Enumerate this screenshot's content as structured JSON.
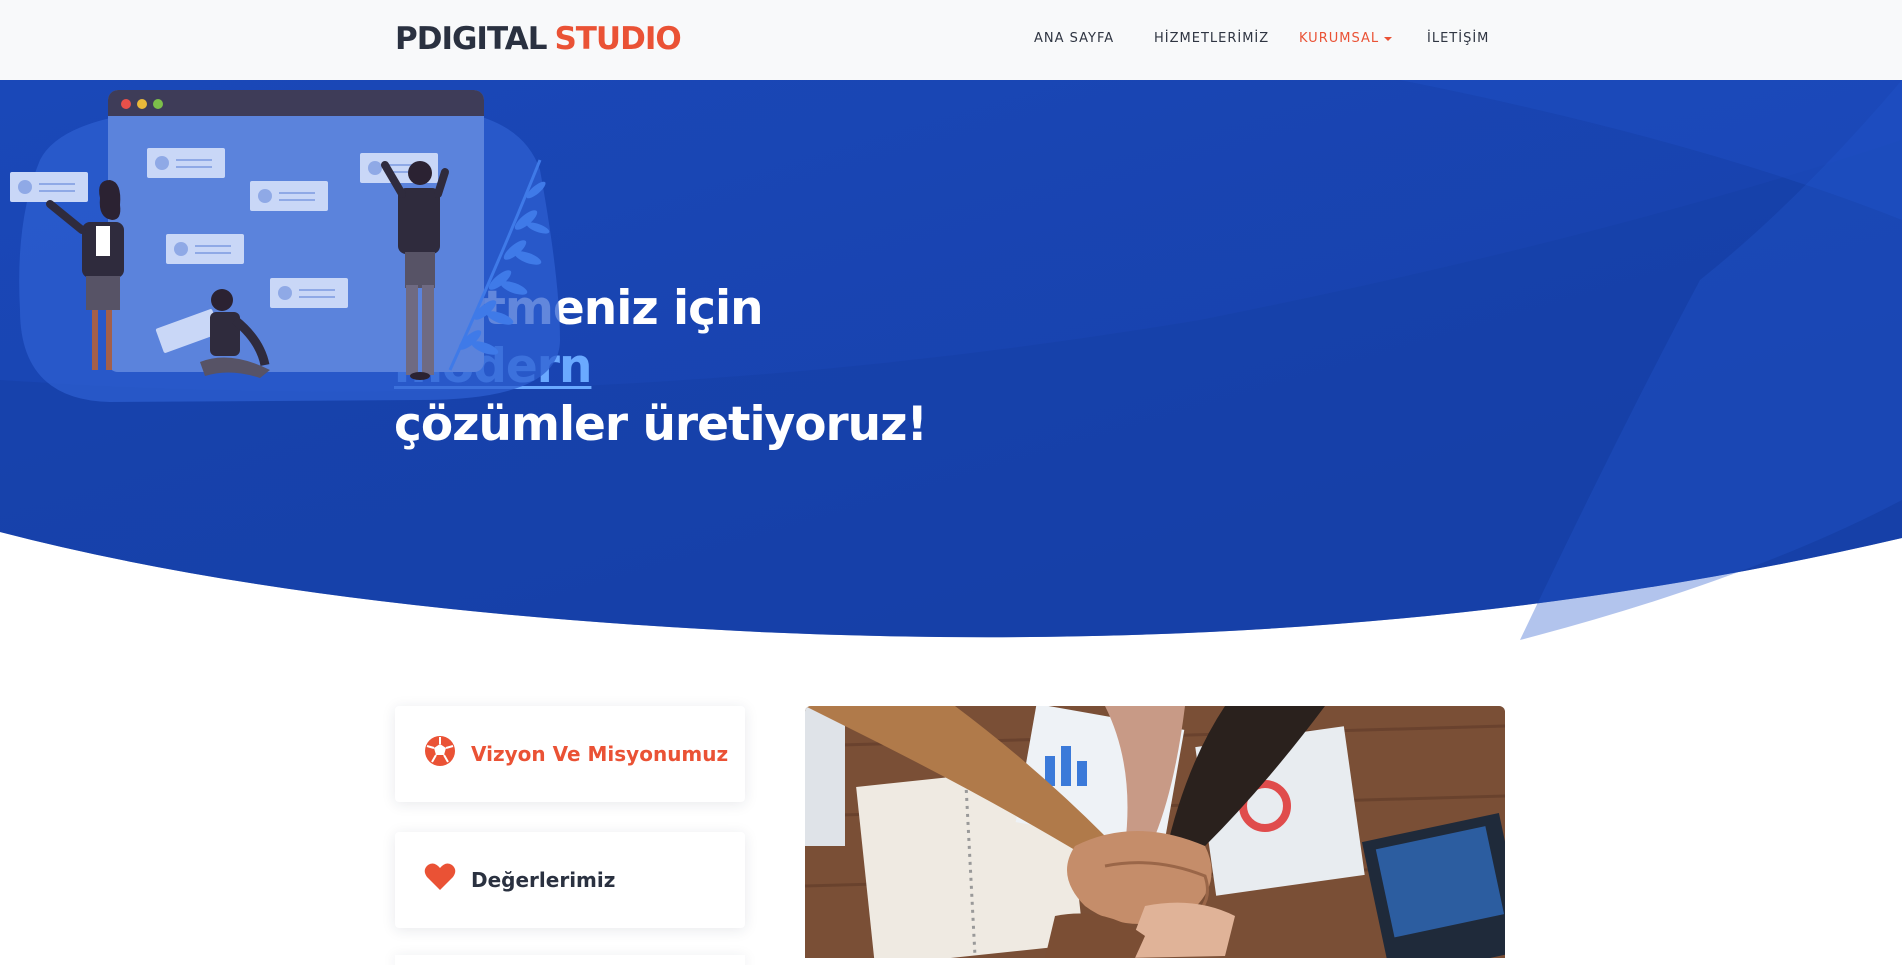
{
  "brand": {
    "part1": "PDIGITAL",
    "part2": "STUDIO"
  },
  "nav": {
    "items": [
      {
        "label": "ANA SAYFA"
      },
      {
        "label": "HİZMETLERİMİZ"
      },
      {
        "label": "KURUMSAL"
      },
      {
        "label": "İLETİŞİM"
      }
    ],
    "active_item": "KURUMSAL"
  },
  "hero": {
    "line1": "İşletmeniz için",
    "highlight": "modern",
    "line3": "çözümler üretiyoruz!"
  },
  "cards": [
    {
      "label": "Vizyon Ve Misyonumuz",
      "icon": "soccer-ball-icon"
    },
    {
      "label": "Değerlerimiz",
      "icon": "heart-icon"
    }
  ],
  "colors": {
    "accent": "#ea5235",
    "hero_blue": "#1746b4",
    "highlight": "#6aa9ff",
    "dark_text": "#2a3140"
  }
}
